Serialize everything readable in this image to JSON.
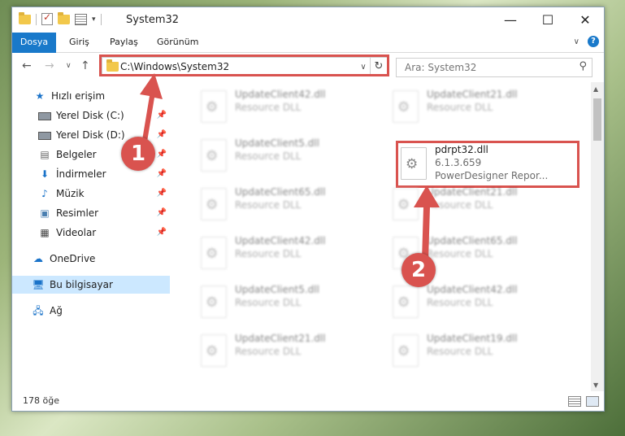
{
  "window": {
    "title": "System32"
  },
  "ribbon": {
    "tabs": [
      "Dosya",
      "Giriş",
      "Paylaş",
      "Görünüm"
    ]
  },
  "address": {
    "path": "C:\\Windows\\System32",
    "search_placeholder": "Ara: System32"
  },
  "nav": {
    "quick_access": "Hızlı erişim",
    "items": [
      "Yerel Disk (C:)",
      "Yerel Disk (D:)",
      "Belgeler",
      "İndirmeler",
      "Müzik",
      "Resimler",
      "Videolar"
    ],
    "onedrive": "OneDrive",
    "this_pc": "Bu bilgisayar",
    "network": "Ağ"
  },
  "files": {
    "left": [
      {
        "name": "UpdateClient42.dll",
        "type": "Resource DLL"
      },
      {
        "name": "UpdateClient5.dll",
        "type": "Resource DLL"
      },
      {
        "name": "UpdateClient65.dll",
        "type": "Resource DLL"
      },
      {
        "name": "UpdateClient42.dll",
        "type": "Resource DLL"
      },
      {
        "name": "UpdateClient5.dll",
        "type": "Resource DLL"
      },
      {
        "name": "UpdateClient21.dll",
        "type": "Resource DLL"
      }
    ],
    "right": [
      {
        "name": "UpdateClient21.dll",
        "type": "Resource DLL"
      },
      {
        "name": "UpdateClient21.dll",
        "type": "Resource DLL"
      },
      {
        "name": "UpdateClient65.dll",
        "type": "Resource DLL"
      },
      {
        "name": "UpdateClient42.dll",
        "type": "Resource DLL"
      },
      {
        "name": "UpdateClient19.dll",
        "type": "Resource DLL"
      }
    ],
    "highlighted": {
      "name": "pdrpt32.dll",
      "version": "6.1.3.659",
      "description": "PowerDesigner Repor..."
    }
  },
  "status": {
    "count": "178 öğe"
  },
  "annotations": {
    "marker1": "1",
    "marker2": "2"
  },
  "colors": {
    "accent": "#1979ca",
    "highlight": "#d9534f",
    "selection": "#cce8ff"
  }
}
